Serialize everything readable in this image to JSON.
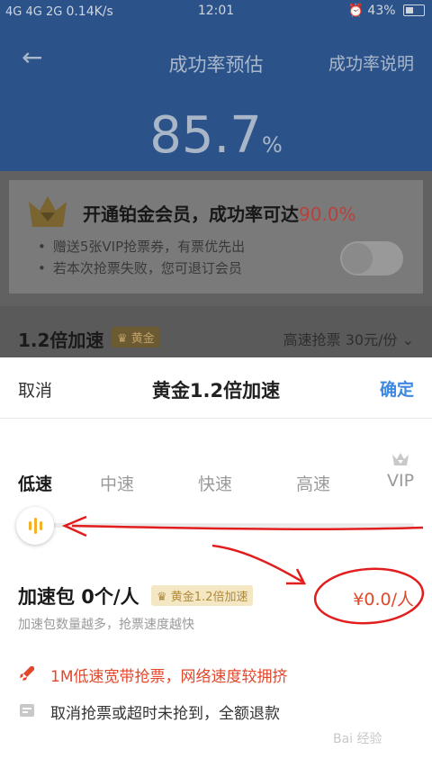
{
  "status_bar": {
    "network": "4G 4G 2G",
    "speed": "0.14K/s",
    "time": "12:01",
    "battery": "43%"
  },
  "nav": {
    "back_icon": "arrow-left-icon",
    "title": "成功率预估",
    "explain": "成功率说明"
  },
  "success_rate": {
    "value": "85.7",
    "unit": "%"
  },
  "vip_promo": {
    "title": "开通铂金会员，成功率可达",
    "rate": "90.0%",
    "bullets": [
      "赠送5张VIP抢票券，有票优先出",
      "若本次抢票失败，您可退订会员"
    ],
    "toggle_on": false
  },
  "speed_row": {
    "label": "1.2倍加速",
    "badge": "黄金",
    "price": "高速抢票 30元/份"
  },
  "sheet": {
    "cancel": "取消",
    "title": "黄金1.2倍加速",
    "confirm": "确定",
    "speed_levels": [
      "低速",
      "中速",
      "快速",
      "高速",
      "VIP"
    ],
    "selected_level": "低速",
    "pack_label": "加速包 0个/人",
    "pack_badge": "黄金1.2倍加速",
    "pack_price": "¥0.0/人",
    "pack_hint": "加速包数量越多，抢票速度越快",
    "features": [
      "1M低速宽带抢票，网络速度较拥挤",
      "取消抢票或超时未抢到，全额退款"
    ]
  },
  "watermark": "Bai 经验",
  "colors": {
    "accent_blue": "#3d88e0",
    "highlight_red": "#e2472a",
    "gold": "#f3b12a",
    "header_blue": "#2c5389"
  }
}
